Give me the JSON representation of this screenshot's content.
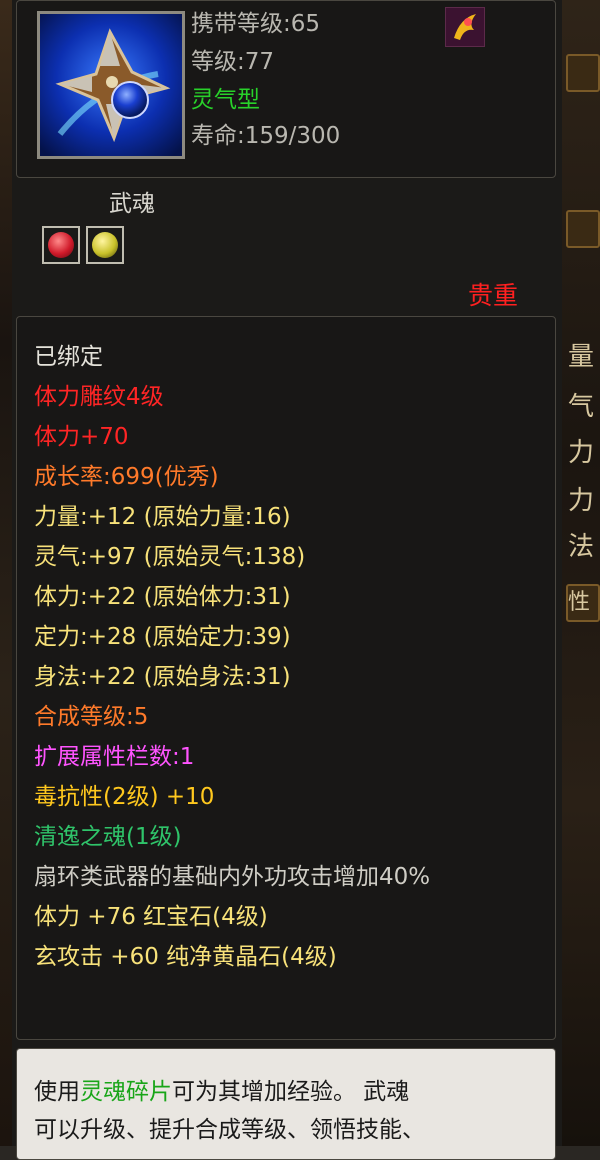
{
  "item": {
    "icon_name": "shuriken-fan-icon",
    "quality_icon_name": "phoenix-badge-icon",
    "carry_level": "携带等级:65",
    "level": "等级:77",
    "type": "灵气型",
    "lifespan": "寿命:159/300"
  },
  "soul": {
    "label": "武魂",
    "gems": [
      {
        "icon_name": "red-gem-icon",
        "color": "#d01a2a"
      },
      {
        "icon_name": "yellow-gem-icon",
        "color": "#c9c22a"
      }
    ],
    "precious": "贵重"
  },
  "stats": [
    {
      "text": "已绑定",
      "color": "#e4e2da"
    },
    {
      "text": "体力雕纹4级",
      "color": "#ff2525"
    },
    {
      "text": "体力+70",
      "color": "#ff2525"
    },
    {
      "text": "成长率:699(优秀)",
      "color": "#ff7a2a"
    },
    {
      "text": "力量:+12 (原始力量:16)",
      "color": "#f8e27a"
    },
    {
      "text": "灵气:+97 (原始灵气:138)",
      "color": "#f8e27a"
    },
    {
      "text": "体力:+22 (原始体力:31)",
      "color": "#f8e27a"
    },
    {
      "text": "定力:+28 (原始定力:39)",
      "color": "#f8e27a"
    },
    {
      "text": "身法:+22 (原始身法:31)",
      "color": "#f8e27a"
    },
    {
      "text": "合成等级:5",
      "color": "#ff7a2a"
    },
    {
      "text": "扩展属性栏数:1",
      "color": "#ff54ff"
    },
    {
      "text": "毒抗性(2级) +10",
      "color": "#ffc81e"
    },
    {
      "text": "清逸之魂(1级)",
      "color": "#2fc46a"
    },
    {
      "text": "扇环类武器的基础内外功攻击增加40%",
      "color": "#cfcdc5"
    },
    {
      "text": "体力 +76 红宝石(4级)",
      "color": "#f8e27a"
    },
    {
      "text": "玄攻击 +60 纯净黄晶石(4级)",
      "color": "#f8e27a"
    }
  ],
  "footer": {
    "line1_pre": "使用",
    "line1_hl": "灵魂碎片",
    "line1_post": "可为其增加经验。 武魂",
    "line2": "可以升级、提升合成等级、领悟技能、"
  },
  "side_glyphs": [
    "量",
    "气",
    "力",
    "力",
    "法",
    "性"
  ]
}
